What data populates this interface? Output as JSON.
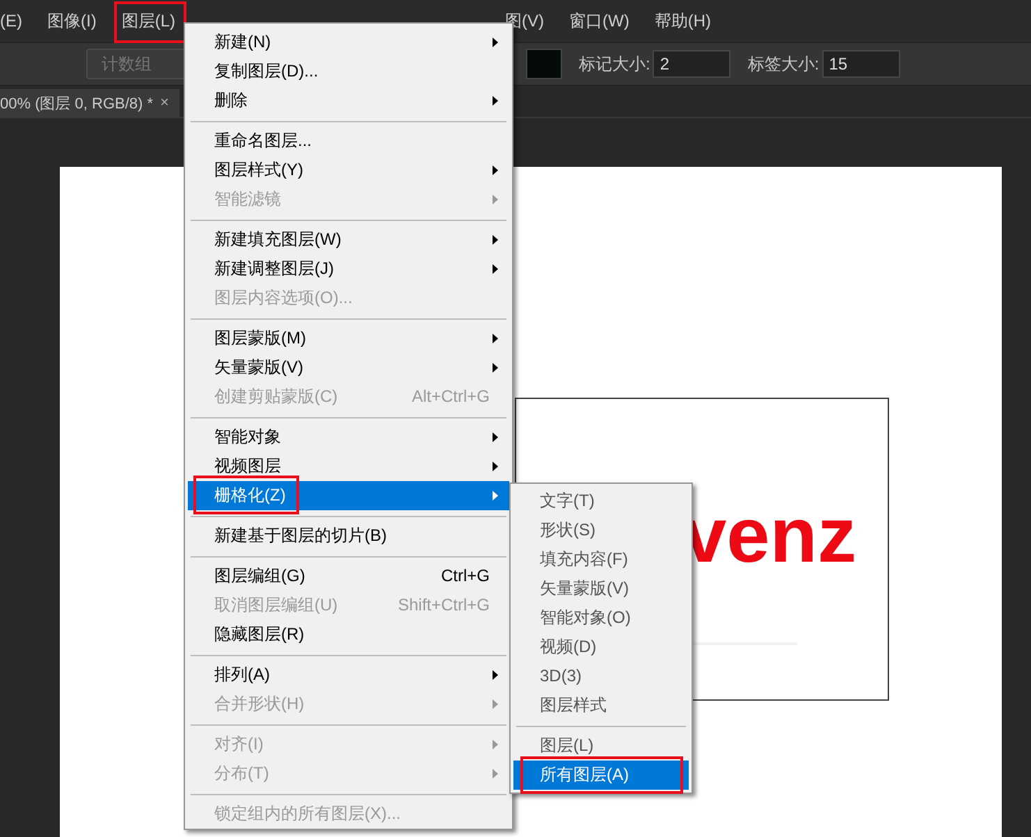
{
  "menubar": [
    {
      "label": "(E)"
    },
    {
      "label": "图像(I)"
    },
    {
      "label": "图层(L)",
      "annotated": true
    },
    {
      "label": "图(V)"
    },
    {
      "label": "窗口(W)"
    },
    {
      "label": "帮助(H)"
    }
  ],
  "options_bar": {
    "dropdown": "计数组",
    "marker_size_label": "标记大小:",
    "marker_size": "2",
    "label_size_label": "标签大小:",
    "label_size": "15"
  },
  "document_tab": {
    "title": "00% (图层 0, RGB/8) *",
    "close": "×"
  },
  "canvas_text": "venz",
  "layer_menu": [
    {
      "kind": "item",
      "label": "新建(N)",
      "submenu": true,
      "disabled": false,
      "selected": false
    },
    {
      "kind": "item",
      "label": "复制图层(D)...",
      "submenu": false,
      "disabled": false,
      "selected": false
    },
    {
      "kind": "item",
      "label": "删除",
      "submenu": true,
      "disabled": false,
      "selected": false
    },
    {
      "kind": "separator"
    },
    {
      "kind": "item",
      "label": "重命名图层...",
      "submenu": false,
      "disabled": false,
      "selected": false
    },
    {
      "kind": "item",
      "label": "图层样式(Y)",
      "submenu": true,
      "disabled": false,
      "selected": false
    },
    {
      "kind": "item",
      "label": "智能滤镜",
      "submenu": true,
      "disabled": true,
      "selected": false
    },
    {
      "kind": "separator"
    },
    {
      "kind": "item",
      "label": "新建填充图层(W)",
      "submenu": true,
      "disabled": false,
      "selected": false
    },
    {
      "kind": "item",
      "label": "新建调整图层(J)",
      "submenu": true,
      "disabled": false,
      "selected": false
    },
    {
      "kind": "item",
      "label": "图层内容选项(O)...",
      "submenu": false,
      "disabled": true,
      "selected": false
    },
    {
      "kind": "separator"
    },
    {
      "kind": "item",
      "label": "图层蒙版(M)",
      "submenu": true,
      "disabled": false,
      "selected": false
    },
    {
      "kind": "item",
      "label": "矢量蒙版(V)",
      "submenu": true,
      "disabled": false,
      "selected": false
    },
    {
      "kind": "item",
      "label": "创建剪贴蒙版(C)",
      "shortcut": "Alt+Ctrl+G",
      "submenu": false,
      "disabled": true,
      "selected": false
    },
    {
      "kind": "separator"
    },
    {
      "kind": "item",
      "label": "智能对象",
      "submenu": true,
      "disabled": false,
      "selected": false
    },
    {
      "kind": "item",
      "label": "视频图层",
      "submenu": true,
      "disabled": false,
      "selected": false
    },
    {
      "kind": "item",
      "label": "栅格化(Z)",
      "submenu": true,
      "disabled": false,
      "selected": true,
      "annotated": true
    },
    {
      "kind": "separator"
    },
    {
      "kind": "item",
      "label": "新建基于图层的切片(B)",
      "submenu": false,
      "disabled": false,
      "selected": false
    },
    {
      "kind": "separator"
    },
    {
      "kind": "item",
      "label": "图层编组(G)",
      "shortcut": "Ctrl+G",
      "submenu": false,
      "disabled": false,
      "selected": false
    },
    {
      "kind": "item",
      "label": "取消图层编组(U)",
      "shortcut": "Shift+Ctrl+G",
      "submenu": false,
      "disabled": true,
      "selected": false
    },
    {
      "kind": "item",
      "label": "隐藏图层(R)",
      "submenu": false,
      "disabled": false,
      "selected": false
    },
    {
      "kind": "separator"
    },
    {
      "kind": "item",
      "label": "排列(A)",
      "submenu": true,
      "disabled": false,
      "selected": false
    },
    {
      "kind": "item",
      "label": "合并形状(H)",
      "submenu": true,
      "disabled": true,
      "selected": false
    },
    {
      "kind": "separator"
    },
    {
      "kind": "item",
      "label": "对齐(I)",
      "submenu": true,
      "disabled": true,
      "selected": false
    },
    {
      "kind": "item",
      "label": "分布(T)",
      "submenu": true,
      "disabled": true,
      "selected": false
    },
    {
      "kind": "separator"
    },
    {
      "kind": "item",
      "label": "锁定组内的所有图层(X)...",
      "submenu": false,
      "disabled": true,
      "selected": false
    }
  ],
  "rasterize_menu": [
    {
      "kind": "item",
      "label": "文字(T)",
      "selected": false
    },
    {
      "kind": "item",
      "label": "形状(S)",
      "selected": false
    },
    {
      "kind": "item",
      "label": "填充内容(F)",
      "selected": false
    },
    {
      "kind": "item",
      "label": "矢量蒙版(V)",
      "selected": false
    },
    {
      "kind": "item",
      "label": "智能对象(O)",
      "selected": false
    },
    {
      "kind": "item",
      "label": "视频(D)",
      "selected": false
    },
    {
      "kind": "item",
      "label": "3D(3)",
      "selected": false
    },
    {
      "kind": "item",
      "label": "图层样式",
      "selected": false
    },
    {
      "kind": "separator"
    },
    {
      "kind": "item",
      "label": "图层(L)",
      "selected": false
    },
    {
      "kind": "item",
      "label": "所有图层(A)",
      "selected": true,
      "annotated": true
    }
  ]
}
